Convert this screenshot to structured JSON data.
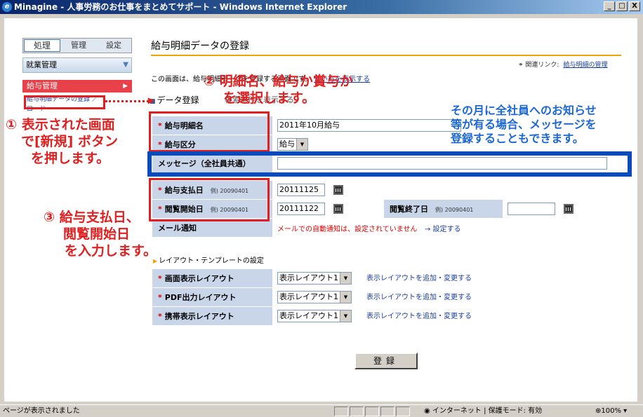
{
  "window": {
    "title": "Minagine - 人事労務のお仕事をまとめてサポート - Windows Internet Explorer",
    "controls": [
      "_",
      "□",
      "X"
    ]
  },
  "sidebar": {
    "tabs": [
      "処理",
      "管理",
      "設定"
    ],
    "section": "就業管理",
    "menu": "給与管理",
    "link1": "給与明細データの登録 ／",
    "link2": "ロード"
  },
  "main": {
    "title": "給与明細データの登録",
    "related_label": "関連リンク:",
    "related_link": "給与明細の管理",
    "description": "この画面は、給与明細データを登録する画面です。",
    "description_link": "使い方を表示する",
    "section_title": "データ登録",
    "section_extra": "検索条件を表示する"
  },
  "form": {
    "payslip_name": {
      "label": "給与明細名",
      "value": "2011年10月給与"
    },
    "pay_type": {
      "label": "給与区分",
      "value": "給与"
    },
    "message": {
      "label": "メッセージ（全社員共通）",
      "value": ""
    },
    "pay_date": {
      "label": "給与支払日",
      "example": "例) 20090401",
      "value": "20111125"
    },
    "view_start": {
      "label": "閲覧開始日",
      "example": "例) 20090401",
      "value": "20111122"
    },
    "view_end": {
      "label": "閲覧終了日",
      "example": "例) 20090401",
      "value": ""
    },
    "mail_notice": {
      "label": "メール通知",
      "value": "メールでの自動通知は、設定されていません",
      "link": "→ 設定する"
    }
  },
  "template": {
    "title": "レイアウト・テンプレートの設定",
    "rows": [
      {
        "label": "画面表示レイアウト",
        "value": "表示レイアウト1",
        "link": "表示レイアウトを追加・変更する"
      },
      {
        "label": "PDF出力レイアウト",
        "value": "表示レイアウト1",
        "link": "表示レイアウトを追加・変更する"
      },
      {
        "label": "携帯表示レイアウト",
        "value": "表示レイアウト1",
        "link": "表示レイアウトを追加・変更する"
      }
    ]
  },
  "submit_label": "登録",
  "statusbar": {
    "left": "ページが表示されました",
    "zone": "インターネット | 保護モード: 有効",
    "zoom": "100%"
  },
  "annotations": {
    "a1_l1": "① 表示された画面",
    "a1_l2": "で[新規] ボタン",
    "a1_l3": "を押します。",
    "a2_l1": "② 明細名、給与か賞与か",
    "a2_l2": "を選択します。",
    "a3_l1": "③ 給与支払日、",
    "a3_l2": "閲覧開始日",
    "a3_l3": "を入力します。",
    "blue_l1": "その月に全社員へのお知らせ",
    "blue_l2": "等が有る場合、メッセージを",
    "blue_l3": "登録することもできます。"
  },
  "colors": {
    "accent": "#f0a400",
    "label_bg": "#c9d6ea",
    "annotation_red": "#e02020",
    "annotation_blue": "#1b67d6"
  }
}
